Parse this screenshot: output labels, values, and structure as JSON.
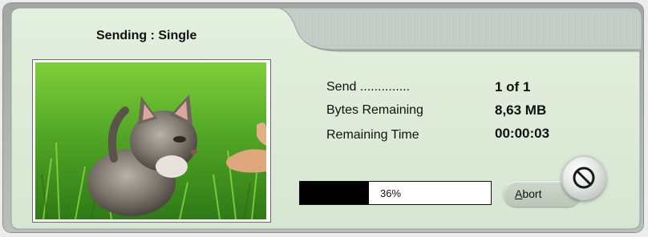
{
  "dialog": {
    "title": "Sending : Single"
  },
  "info": {
    "send_label": "Send ..............",
    "send_value": "1 of 1",
    "bytes_label": "Bytes Remaining",
    "bytes_value": "8,63 MB",
    "time_label": "Remaining Time",
    "time_value": "00:00:03"
  },
  "progress": {
    "percent": 36,
    "text": "36%"
  },
  "abort": {
    "label_first": "A",
    "label_rest": "bort",
    "icon": "no-entry-icon"
  },
  "photo": {
    "subject": "kitten-in-grass-image"
  },
  "colors": {
    "panel_bg": "#dcead7",
    "tab_bg": "#c5cdc9",
    "progress_fill": "#000000"
  }
}
